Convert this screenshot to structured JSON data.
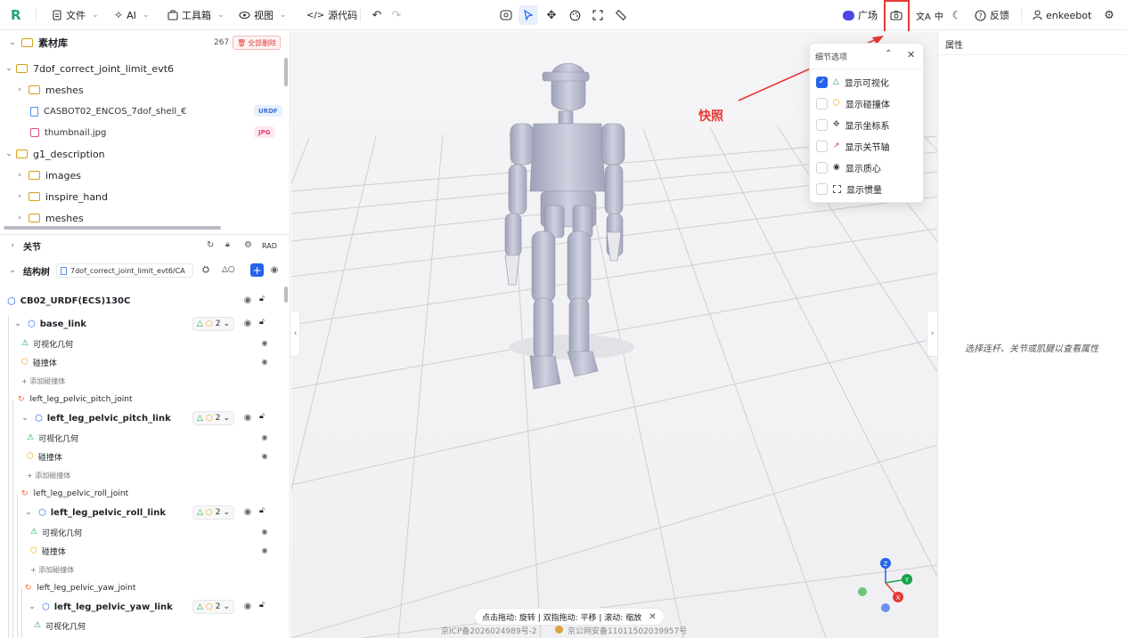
{
  "toolbar": {
    "logo": "R",
    "file": "文件",
    "ai": "AI",
    "toolbox": "工具箱",
    "view": "视图",
    "source": "源代码",
    "plaza": "广场",
    "lang": "中",
    "feedback": "反馈",
    "user": "enkeebot"
  },
  "assets": {
    "title": "素材库",
    "count": "267",
    "delete_all": "全部删除",
    "items": [
      {
        "label": "7dof_correct_joint_limit_evt6"
      },
      {
        "label": "meshes"
      },
      {
        "label": "CASBOT02_ENCOS_7dof_shell_€",
        "badge": "URDF"
      },
      {
        "label": "thumbnail.jpg",
        "badge": "JPG"
      },
      {
        "label": "g1_description"
      },
      {
        "label": "images"
      },
      {
        "label": "inspire_hand"
      },
      {
        "label": "meshes"
      }
    ]
  },
  "joints": {
    "title": "关节",
    "rad": "RAD"
  },
  "structure": {
    "title": "结构树",
    "file": "7dof_correct_joint_limit_evt6/CA",
    "root": "CB02_URDF(ECS)130C",
    "nodes": [
      {
        "label": "base_link",
        "count": "2"
      },
      {
        "label": "可视化几何"
      },
      {
        "label": "碰撞体"
      },
      {
        "label": "+ 添加碰撞体"
      },
      {
        "label": "left_leg_pelvic_pitch_joint"
      },
      {
        "label": "left_leg_pelvic_pitch_link",
        "count": "2"
      },
      {
        "label": "可视化几何"
      },
      {
        "label": "碰撞体"
      },
      {
        "label": "+ 添加碰撞体"
      },
      {
        "label": "left_leg_pelvic_roll_joint"
      },
      {
        "label": "left_leg_pelvic_roll_link",
        "count": "2"
      },
      {
        "label": "可视化几何"
      },
      {
        "label": "碰撞体"
      },
      {
        "label": "+ 添加碰撞体"
      },
      {
        "label": "left_leg_pelvic_yaw_joint"
      },
      {
        "label": "left_leg_pelvic_yaw_link",
        "count": "2"
      },
      {
        "label": "可视化几何"
      }
    ]
  },
  "properties": {
    "title": "属性",
    "empty_hint": "选择连杆、关节或肌腱以查看属性"
  },
  "detail_popup": {
    "title": "细节选项",
    "options": [
      {
        "label": "显示可视化",
        "checked": true
      },
      {
        "label": "显示碰撞体",
        "checked": false
      },
      {
        "label": "显示坐标系",
        "checked": false
      },
      {
        "label": "显示关节轴",
        "checked": false
      },
      {
        "label": "显示质心",
        "checked": false
      },
      {
        "label": "显示惯量",
        "checked": false
      }
    ]
  },
  "annotation": {
    "label": "快照",
    "color": "#e53935"
  },
  "hint": "点击拖动: 旋转 | 双指拖动: 平移 | 滚动: 缩放",
  "footer": {
    "icp": "京ICP备2026024989号-2",
    "police": "京公网安备11011502039957号"
  },
  "gizmo": {
    "z": "Z",
    "y": "Y",
    "x": "X"
  },
  "colors": {
    "accent": "#2563eb",
    "danger": "#e53935",
    "robot": "#b9bccf"
  }
}
